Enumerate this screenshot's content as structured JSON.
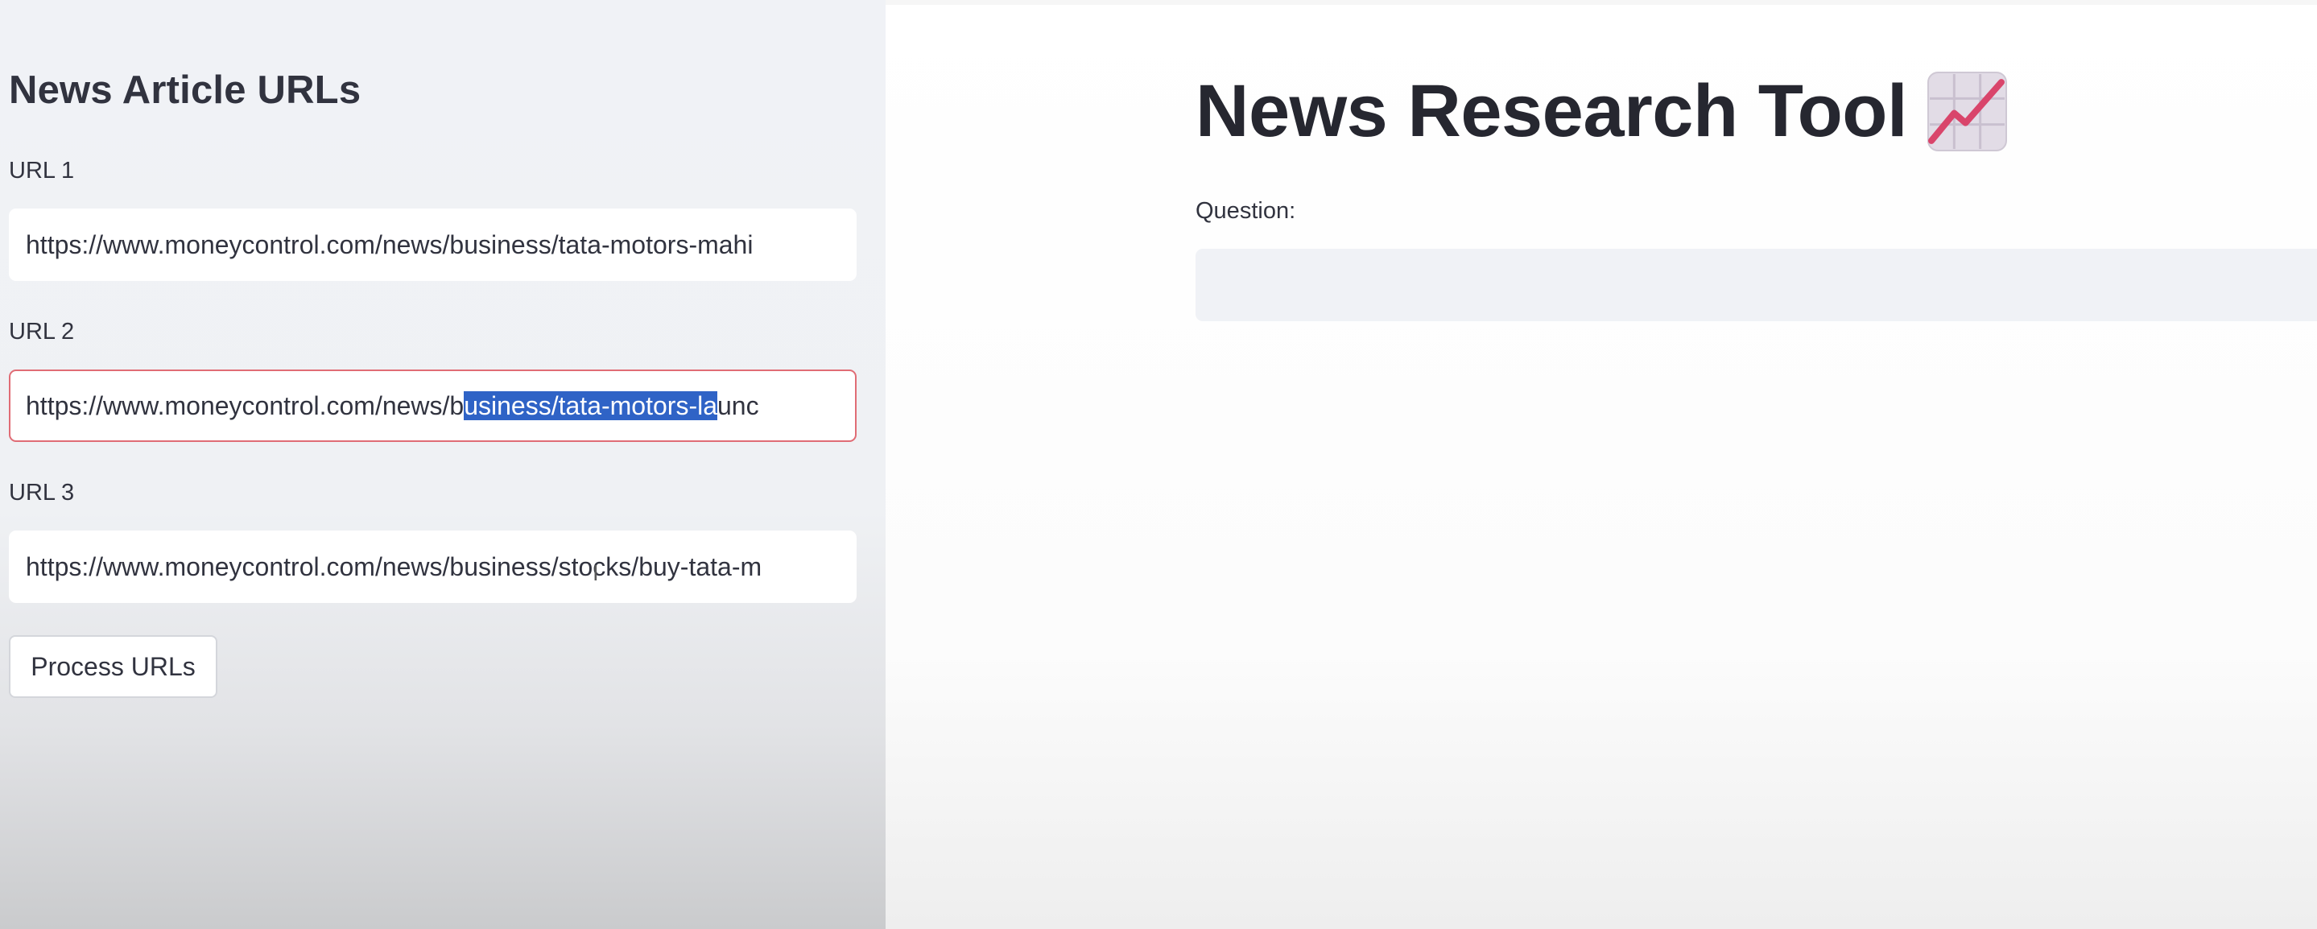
{
  "sidebar": {
    "title": "News Article URLs",
    "url1": {
      "label": "URL 1",
      "value": "https://www.moneycontrol.com/news/business/tata-motors-mahi"
    },
    "url2": {
      "label": "URL 2",
      "value_before": "https://www.moneycontrol.com/news/b",
      "value_selected": "usiness/tata-motors-la",
      "value_after": "unc"
    },
    "url3": {
      "label": "URL 3",
      "value": "https://www.moneycontrol.com/news/business/stocks/buy-tata-m"
    },
    "process_button": "Process URLs"
  },
  "main": {
    "title": "News Research Tool",
    "title_icon": "chart-increasing-icon",
    "question": {
      "label": "Question:",
      "value": ""
    }
  },
  "colors": {
    "sidebar_bg": "#f0f2f6",
    "focus_border": "#e06c75",
    "selection": "#2f63c6",
    "text": "#31333f",
    "title": "#262730",
    "chart_line": "#d9456b",
    "chart_bg": "#e2dce6"
  }
}
